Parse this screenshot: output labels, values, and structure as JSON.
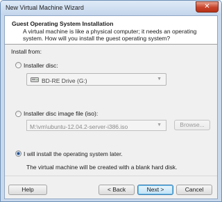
{
  "window": {
    "title": "New Virtual Machine Wizard",
    "close_glyph": "✕"
  },
  "header": {
    "title": "Guest Operating System Installation",
    "description": "A virtual machine is like a physical computer; it needs an operating system. How will you install the guest operating system?"
  },
  "install_from_label": "Install from:",
  "options": {
    "disc": {
      "label": "Installer disc:",
      "selected": false,
      "drive": "BD-RE Drive (G:)"
    },
    "iso": {
      "label": "Installer disc image file (iso):",
      "selected": false,
      "path": "M:\\vm\\ubuntu-12.04.2-server-i386.iso",
      "browse_label": "Browse..."
    },
    "later": {
      "label": "I will install the operating system later.",
      "selected": true,
      "note": "The virtual machine will be created with a blank hard disk."
    }
  },
  "footer": {
    "help_label": "Help",
    "back_label": "< Back",
    "next_label": "Next >",
    "cancel_label": "Cancel"
  },
  "colors": {
    "accent": "#1f4d8a",
    "title_bg": "#c9d9ec"
  }
}
